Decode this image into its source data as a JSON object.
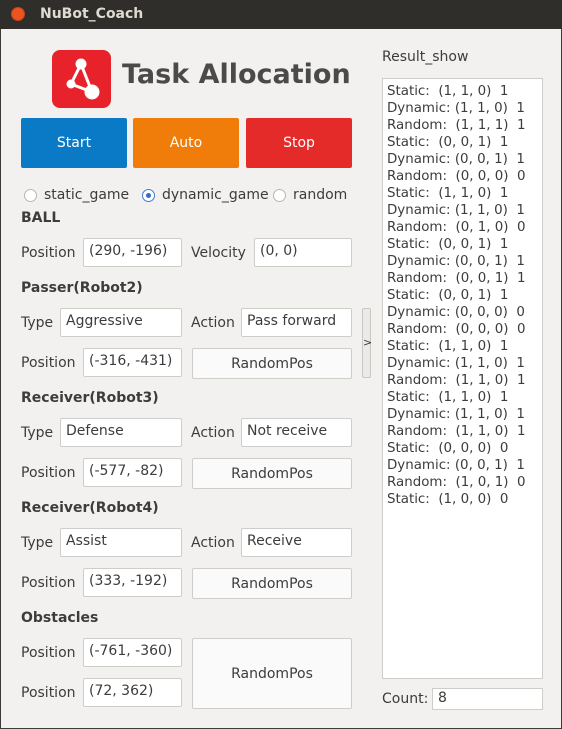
{
  "window": {
    "title": "NuBot_Coach"
  },
  "header": {
    "title": "Task Allocation"
  },
  "controls": {
    "start": "Start",
    "auto": "Auto",
    "stop": "Stop"
  },
  "modes": [
    {
      "label": "static_game",
      "selected": false
    },
    {
      "label": "dynamic_game",
      "selected": true
    },
    {
      "label": "random",
      "selected": false
    }
  ],
  "ball": {
    "heading": "BALL",
    "position_label": "Position",
    "position": "(290, -196)",
    "velocity_label": "Velocity",
    "velocity": "(0, 0)"
  },
  "passer": {
    "heading": "Passer(Robot2)",
    "type_label": "Type",
    "type": "Aggressive",
    "action_label": "Action",
    "action": "Pass forward",
    "position_label": "Position",
    "position": "(-316, -431)",
    "random_label": "RandomPos"
  },
  "receiver3": {
    "heading": "Receiver(Robot3)",
    "type_label": "Type",
    "type": "Defense",
    "action_label": "Action",
    "action": "Not receive",
    "position_label": "Position",
    "position": "(-577, -82)",
    "random_label": "RandomPos"
  },
  "receiver4": {
    "heading": "Receiver(Robot4)",
    "type_label": "Type",
    "type": "Assist",
    "action_label": "Action",
    "action": "Receive",
    "position_label": "Position",
    "position": "(333, -192)",
    "random_label": "RandomPos"
  },
  "obstacles": {
    "heading": "Obstacles",
    "position_label": "Position",
    "position1": "(-761, -360)",
    "position2": "(72, 362)",
    "random_label": "RandomPos"
  },
  "splitter": {
    "glyph": ">"
  },
  "result": {
    "label": "Result_show",
    "lines": [
      "Static:  (1, 1, 0)  1",
      "Dynamic: (1, 1, 0)  1",
      "Random:  (1, 1, 1)  1",
      "Static:  (0, 0, 1)  1",
      "Dynamic: (0, 0, 1)  1",
      "Random:  (0, 0, 0)  0",
      "Static:  (1, 1, 0)  1",
      "Dynamic: (1, 1, 0)  1",
      "Random:  (0, 1, 0)  0",
      "Static:  (0, 0, 1)  1",
      "Dynamic: (0, 0, 1)  1",
      "Random:  (0, 0, 1)  1",
      "Static:  (0, 0, 1)  1",
      "Dynamic: (0, 0, 0)  0",
      "Random:  (0, 0, 0)  0",
      "Static:  (1, 1, 0)  1",
      "Dynamic: (1, 1, 0)  1",
      "Random:  (1, 1, 0)  1",
      "Static:  (1, 1, 0)  1",
      "Dynamic: (1, 1, 0)  1",
      "Random:  (1, 1, 0)  1",
      "Static:  (0, 0, 0)  0",
      "Dynamic: (0, 0, 1)  1",
      "Random:  (1, 0, 1)  0",
      "Static:  (1, 0, 0)  0"
    ]
  },
  "count": {
    "label": "Count:",
    "value": "8"
  },
  "colors": {
    "start": "#0a7ac6",
    "auto": "#f07c0a",
    "stop": "#e52a2a",
    "logo": "#e8222a",
    "close": "#e95420"
  },
  "icons": {
    "logo": "share-nodes-icon",
    "close": "close-icon"
  }
}
